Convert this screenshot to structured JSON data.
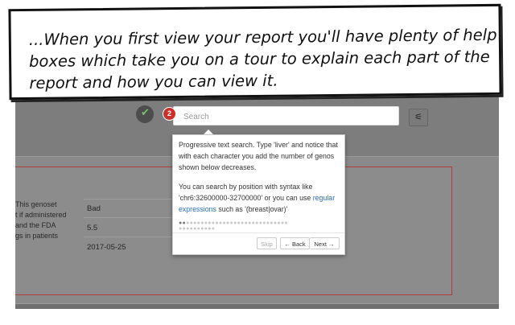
{
  "caption": {
    "text": "...When you first view your report you'll have plenty of help boxes which take you on a tour to explain each part of the report and how you can view it."
  },
  "search": {
    "placeholder": "Search",
    "step_badge": "2"
  },
  "report_card": {
    "side_text": [
      "This genoset",
      "t if administered",
      "and the FDA",
      "gs in patients"
    ],
    "values": [
      "Bad",
      "5.5",
      "2017-05-25"
    ]
  },
  "tour": {
    "paragraph1": "Progressive text search. Type 'liver' and notice that with each character you add the number of genos shown below decreases.",
    "paragraph2_prefix": "You can search by position with syntax like 'chr6:32600000-32700000' or you can use",
    "link_text": "regular expressions",
    "paragraph2_suffix": "such as '(breast|ovar)'",
    "buttons": {
      "skip": "Skip",
      "back": "← Back",
      "next": "Next →"
    },
    "step_count": 40,
    "current_step": 2
  },
  "icons": [
    "check-icon",
    "filter-settings-icon"
  ],
  "colors": {
    "badge": "#c9302c",
    "link": "#2a6ebb",
    "card_border": "#b03c3c"
  }
}
